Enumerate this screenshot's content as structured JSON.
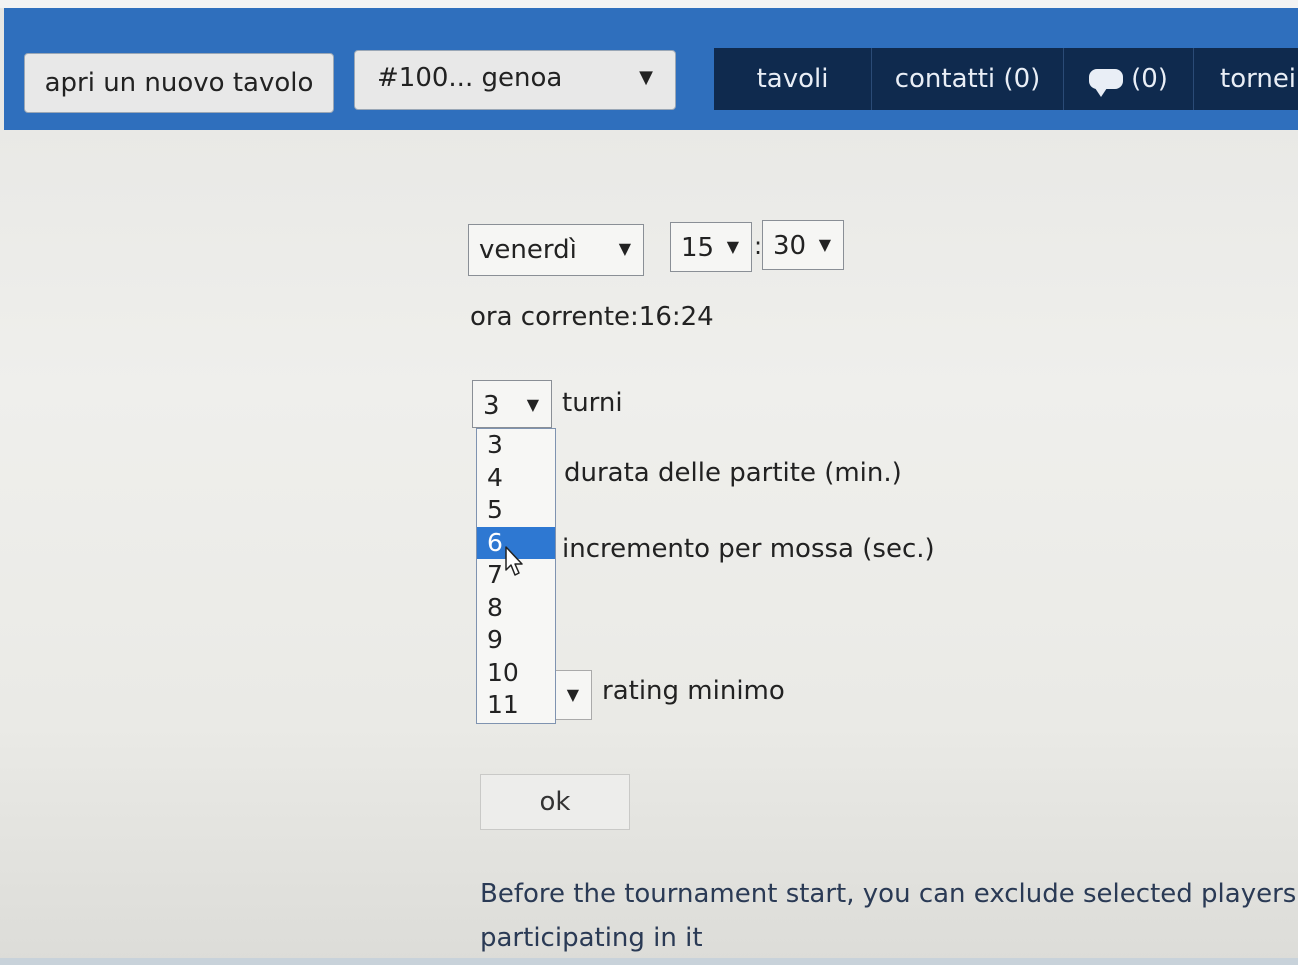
{
  "header": {
    "new_table_label": "apri un nuovo tavolo",
    "table_select_value": "#100... genoa",
    "nav": {
      "tables": "tavoli",
      "contacts": "contatti (0)",
      "messages": "(0)",
      "tournaments": "tornei"
    }
  },
  "schedule": {
    "day": "venerdì",
    "hour": "15",
    "colon": ":",
    "minute": "30",
    "current_time": "ora corrente:16:24"
  },
  "rounds": {
    "value": "3",
    "label": "turni",
    "options": [
      "3",
      "4",
      "5",
      "6",
      "7",
      "8",
      "9",
      "10",
      "11"
    ],
    "highlighted": "6"
  },
  "labels": {
    "duration": "durata delle partite (min.)",
    "increment": "incremento per mossa (sec.)",
    "rating": "rating minimo"
  },
  "ok_label": "ok",
  "note": "Before the tournament start, you can exclude selected players participating in it",
  "colors": {
    "header_bg": "#2f6fbd",
    "nav_bg": "#0f2a4e",
    "selected_option": "#2e78d2"
  },
  "icons": {
    "dropdown_arrow": "triangle-down-icon",
    "chat": "chat-bubble-icon",
    "cursor": "mouse-pointer-icon"
  }
}
